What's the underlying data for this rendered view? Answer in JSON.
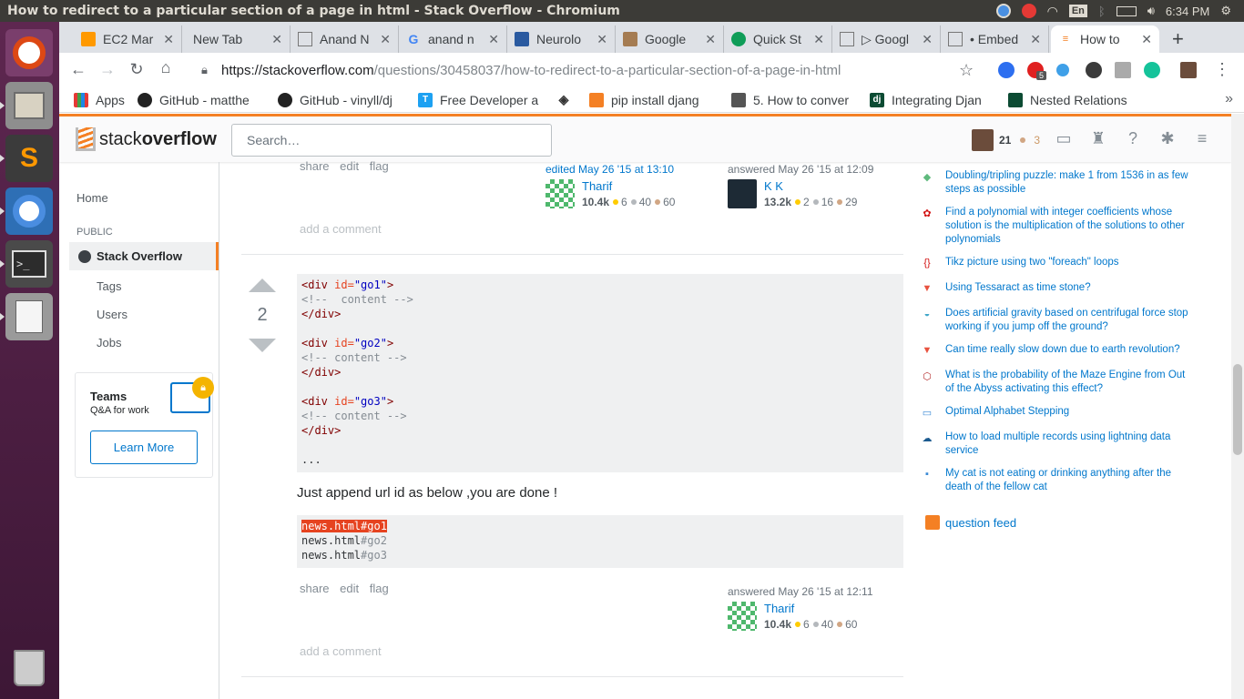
{
  "os": {
    "window_title": "How to redirect to a particular section of a page in html - Stack Overflow - Chromium",
    "lang": "En",
    "clock": "6:34 PM"
  },
  "browser": {
    "tabs": [
      {
        "label": "EC2 Mar"
      },
      {
        "label": "New Tab"
      },
      {
        "label": "Anand N"
      },
      {
        "label": "anand n"
      },
      {
        "label": "Neurolo"
      },
      {
        "label": "Google"
      },
      {
        "label": "Quick St"
      },
      {
        "label": "▷ Googl"
      },
      {
        "label": "• Embed"
      },
      {
        "label": "How to"
      }
    ],
    "url_host": "https://stackoverflow.com",
    "url_path": "/questions/30458037/how-to-redirect-to-a-particular-section-of-a-page-in-html",
    "ext_badge": "5",
    "bookmarks": [
      {
        "label": "Apps"
      },
      {
        "label": "GitHub - matthe"
      },
      {
        "label": "GitHub - vinyll/dj"
      },
      {
        "label": "Free Developer a"
      },
      {
        "label": ""
      },
      {
        "label": "pip install djang"
      },
      {
        "label": "5. How to conver"
      },
      {
        "label": "Integrating Djan"
      },
      {
        "label": "Nested Relations"
      }
    ],
    "bookmarks_more": "»"
  },
  "so": {
    "logo_prefix": "stack",
    "logo_suffix": "overflow",
    "search_placeholder": "Search…",
    "user_rep": "21",
    "user_bronze": "3",
    "nav": {
      "home": "Home",
      "public": "PUBLIC",
      "stackoverflow": "Stack Overflow",
      "tags": "Tags",
      "users": "Users",
      "jobs": "Jobs"
    },
    "teams": {
      "title": "Teams",
      "subtitle": "Q&A for work",
      "button": "Learn More"
    }
  },
  "answer1": {
    "actions": [
      "share",
      "edit",
      "flag"
    ],
    "edited": "edited May 26 '15 at 13:10",
    "editor": {
      "name": "Tharif",
      "rep": "10.4k",
      "gold": "6",
      "silver": "40",
      "bronze": "60"
    },
    "answered": "answered May 26 '15 at 12:09",
    "author": {
      "name": "K K",
      "rep": "13.2k",
      "gold": "2",
      "silver": "16",
      "bronze": "29"
    },
    "add_comment": "add a comment"
  },
  "answer2": {
    "votes": "2",
    "code1": [
      {
        "tag_open": "<div ",
        "attr": "id=",
        "val": "\"go1\"",
        "tag_close": ">"
      },
      {
        "comment": "<!--  content -->"
      },
      {
        "tag_end": "</div>"
      },
      {
        "tag_open": "<div ",
        "attr": "id=",
        "val": "\"go2\"",
        "tag_close": ">"
      },
      {
        "comment": "<!-- content -->"
      },
      {
        "tag_end": "</div>"
      },
      {
        "tag_open": "<div ",
        "attr": "id=",
        "val": "\"go3\"",
        "tag_close": ">"
      },
      {
        "comment": "<!-- content -->"
      },
      {
        "tag_end": "</div>"
      },
      {
        "text": "..."
      }
    ],
    "paragraph": "Just append url id as below ,you are done !",
    "code2": [
      {
        "file": "news.html",
        "anchor": "#go1"
      },
      {
        "file": "news.html",
        "anchor": "#go2"
      },
      {
        "file": "news.html",
        "anchor": "#go3"
      }
    ],
    "actions": [
      "share",
      "edit",
      "flag"
    ],
    "answered": "answered May 26 '15 at 12:11",
    "author": {
      "name": "Tharif",
      "rep": "10.4k",
      "gold": "6",
      "silver": "40",
      "bronze": "60"
    },
    "add_comment": "add a comment"
  },
  "hot_questions": [
    {
      "title": "Doubling/tripling puzzle: make 1 from 1536 in as few steps as possible",
      "icon_color": "#5fba7d"
    },
    {
      "title": "Find a polynomial with integer coefficients whose solution is the multiplication of the solutions to other polynomials",
      "icon_color": "#d21010"
    },
    {
      "title": "Tikz picture using two \"foreach\" loops",
      "icon_color": "#d21010"
    },
    {
      "title": "Using Tessaract as time stone?",
      "icon_color": "#e8523f"
    },
    {
      "title": "Does artificial gravity based on centrifugal force stop working if you jump off the ground?",
      "icon_color": "#3fa6c9"
    },
    {
      "title": "Can time really slow down due to earth revolution?",
      "icon_color": "#e8523f"
    },
    {
      "title": "What is the probability of the Maze Engine from Out of the Abyss activating this effect?",
      "icon_color": "#b52d2d"
    },
    {
      "title": "Optimal Alphabet Stepping",
      "icon_color": "#3b8ad6"
    },
    {
      "title": "How to load multiple records using lightning data service",
      "icon_color": "#1b5a8f"
    },
    {
      "title": "My cat is not eating or drinking anything after the death of the fellow cat",
      "icon_color": "#3b8ad6"
    }
  ],
  "question_feed": "question feed"
}
